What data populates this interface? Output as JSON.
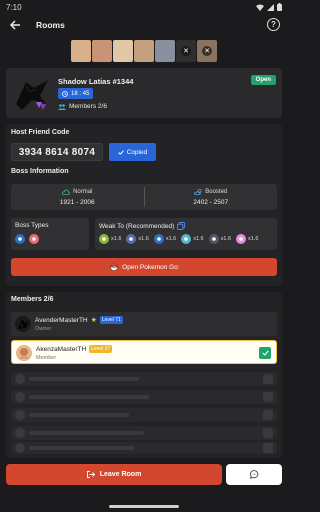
{
  "status_bar": {
    "time": "7:10"
  },
  "header": {
    "title": "Rooms",
    "help_label": "?"
  },
  "thumbnails": [
    {
      "color": "#d8b08a"
    },
    {
      "color": "#c99476"
    },
    {
      "color": "#e2c6a8"
    },
    {
      "color": "#c4a07e"
    },
    {
      "color": "#8a8f9e"
    },
    {
      "color": "#2e2e30",
      "close": "✕"
    },
    {
      "color": "#8a7460",
      "close": "✕"
    }
  ],
  "boss": {
    "name": "Shadow Latias #1344",
    "timer": "18 : 45",
    "members": "Members 2/6",
    "status": "Open"
  },
  "friend_code": {
    "label": "Host Friend Code",
    "value": "3934 8614 8074",
    "copied_label": "Copied"
  },
  "boss_info": {
    "label": "Boss Information",
    "normal_label": "Normal",
    "normal_value": "1921 - 2006",
    "boosted_label": "Boosted",
    "boosted_value": "2402 - 2507"
  },
  "boss_types": {
    "label": "Boss Types",
    "types": [
      {
        "name": "dragon",
        "color": "#2f6fc2"
      },
      {
        "name": "psychic",
        "color": "#ec6b78"
      }
    ]
  },
  "weak_to": {
    "label": "Weak To (Recommended)",
    "items": [
      {
        "type": "bug",
        "color": "#8fb63a",
        "mult": "x1.6"
      },
      {
        "type": "ghost",
        "color": "#5a6aac",
        "mult": "x1.6"
      },
      {
        "type": "dragon",
        "color": "#2f6fc2",
        "mult": "x1.6"
      },
      {
        "type": "ice",
        "color": "#56b7c5",
        "mult": "x1.6"
      },
      {
        "type": "dark",
        "color": "#5b5466",
        "mult": "x1.6"
      },
      {
        "type": "fairy",
        "color": "#e48fdc",
        "mult": "x1.6"
      }
    ]
  },
  "open_go_label": "Open Pokemon Go",
  "members": {
    "label": "Members 2/6",
    "list": [
      {
        "name": "AvenderMasterTH",
        "level": "Level 71",
        "role": "Owner",
        "level_color": "#2866d8"
      },
      {
        "name": "AkenzaMasterTH",
        "level": "Level 37",
        "role": "Member",
        "level_color": "#f0b52b"
      }
    ]
  },
  "footer": {
    "leave_label": "Leave Room"
  }
}
